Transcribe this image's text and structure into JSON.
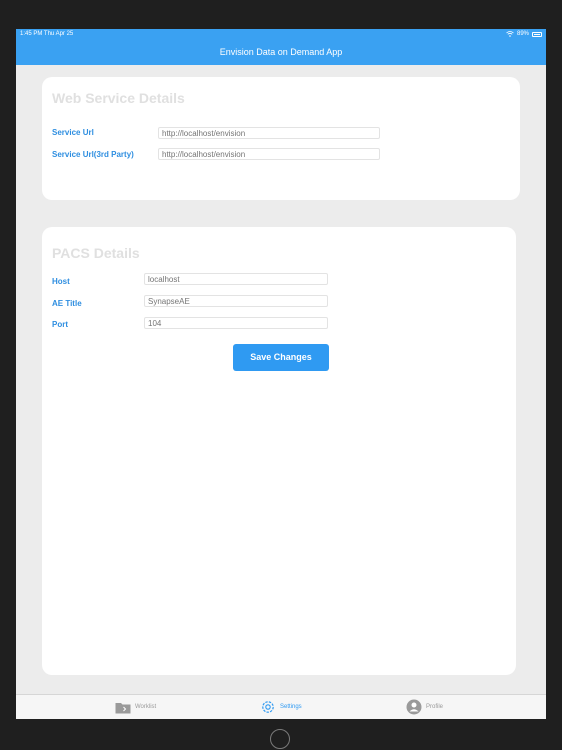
{
  "status_bar": {
    "time": "1:45 PM  Thu Apr 25",
    "battery": "89%"
  },
  "app_title": "Envision Data on Demand App",
  "web_service": {
    "title": "Web Service Details",
    "service_url_label": "Service Url",
    "service_url_placeholder": "http://localhost/envision",
    "service_url_3rd_label": "Service Url(3rd Party)",
    "service_url_3rd_placeholder": "http://localhost/envision"
  },
  "pacs": {
    "title": "PACS Details",
    "host_label": "Host",
    "host_placeholder": "localhost",
    "ae_title_label": "AE Title",
    "ae_title_placeholder": "SynapseAE",
    "port_label": "Port",
    "port_placeholder": "104",
    "save_label": "Save Changes"
  },
  "tabs": [
    {
      "label": "Worklist",
      "icon": "folder-icon",
      "active": false
    },
    {
      "label": "Settings",
      "icon": "gear-icon",
      "active": true
    },
    {
      "label": "Profile",
      "icon": "person-icon",
      "active": false
    }
  ],
  "colors": {
    "accent": "#3aa1f2",
    "label": "#2e8ee0",
    "background": "#ececec"
  }
}
